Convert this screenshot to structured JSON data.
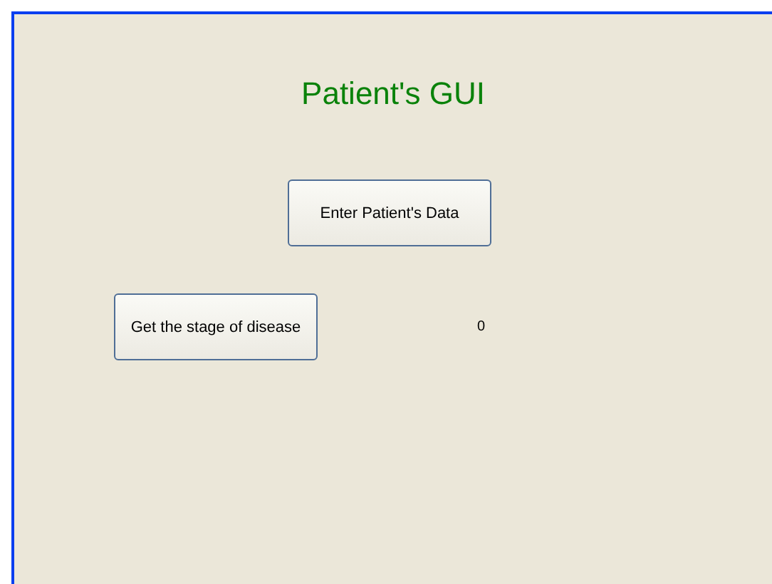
{
  "title": "Patient's GUI",
  "buttons": [
    {
      "label": "Enter Patient's Data"
    },
    {
      "label": "Get the stage of disease"
    }
  ],
  "stage_value": "0"
}
